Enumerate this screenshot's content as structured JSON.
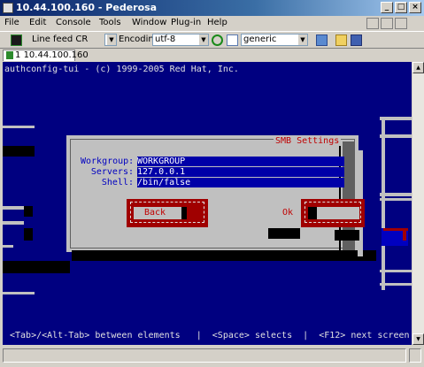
{
  "window": {
    "title": "10.44.100.160 - Pederosa",
    "controls": [
      "_",
      "□",
      "×"
    ]
  },
  "menu": [
    "File",
    "Edit",
    "Console",
    "Tools",
    "Window",
    "Plug-in",
    "Help"
  ],
  "toolbar": {
    "line_feed": "Line feed CR",
    "encoding_label": "Encoding",
    "encoding_value": "utf-8",
    "terminal_type": "generic"
  },
  "tabs": [
    {
      "number": "1",
      "label": "10.44.100.160"
    }
  ],
  "terminal": {
    "header": "authconfig-tui - (c) 1999-2005 Red Hat, Inc.",
    "dialog": {
      "title": "SMB Settings",
      "fields": [
        {
          "label": "Workgroup:",
          "value": "WORKGROUP"
        },
        {
          "label": "Servers:",
          "value": "127.0.0.1"
        },
        {
          "label": "Shell:",
          "value": "/bin/false"
        }
      ],
      "buttons": {
        "back": "Back",
        "ok": "Ok"
      }
    },
    "footer": "<Tab>/<Alt-Tab> between elements   |  <Space> selects  |  <F12> next screen"
  },
  "colors": {
    "terminal_bg": "#000080",
    "dialog_bg": "#c0c0c0",
    "accent_red": "#a00000",
    "field_text": "#ffffff",
    "label_text": "#0000c0"
  }
}
